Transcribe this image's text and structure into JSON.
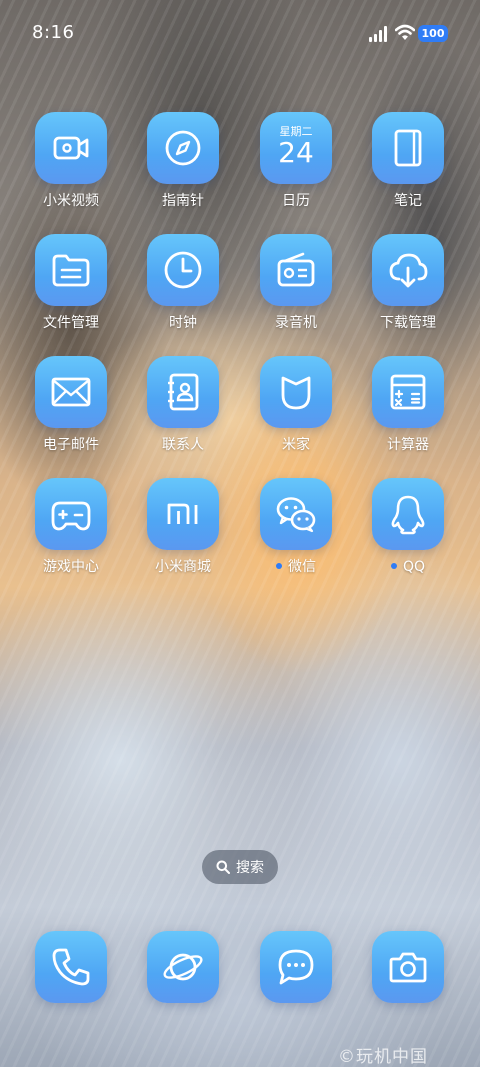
{
  "status_bar": {
    "time": "8:16",
    "battery": "100"
  },
  "apps": [
    {
      "label": "小米视频",
      "icon": "video-camera-icon"
    },
    {
      "label": "指南针",
      "icon": "compass-icon"
    },
    {
      "label": "日历",
      "icon": "calendar-icon",
      "weekday": "星期二",
      "date": "24"
    },
    {
      "label": "笔记",
      "icon": "notebook-icon"
    },
    {
      "label": "文件管理",
      "icon": "folder-icon"
    },
    {
      "label": "时钟",
      "icon": "clock-icon"
    },
    {
      "label": "录音机",
      "icon": "radio-recorder-icon"
    },
    {
      "label": "下载管理",
      "icon": "cloud-download-icon"
    },
    {
      "label": "电子邮件",
      "icon": "envelope-icon"
    },
    {
      "label": "联系人",
      "icon": "contacts-book-icon"
    },
    {
      "label": "米家",
      "icon": "mijia-icon"
    },
    {
      "label": "计算器",
      "icon": "calculator-icon"
    },
    {
      "label": "游戏中心",
      "icon": "gamepad-icon"
    },
    {
      "label": "小米商城",
      "icon": "mi-logo-icon"
    },
    {
      "label": "微信",
      "icon": "wechat-icon",
      "dot": true
    },
    {
      "label": "QQ",
      "icon": "qq-penguin-icon",
      "dot": true
    }
  ],
  "search": {
    "label": "搜索"
  },
  "dock": [
    {
      "icon": "phone-icon"
    },
    {
      "icon": "planet-browser-icon"
    },
    {
      "icon": "message-bubble-icon"
    },
    {
      "icon": "camera-icon"
    }
  ],
  "watermark": "©玩机中国",
  "colors": {
    "icon_top": "#66c6fb",
    "icon_bottom": "#5b98f0",
    "badge_blue": "#2f7cf6"
  }
}
